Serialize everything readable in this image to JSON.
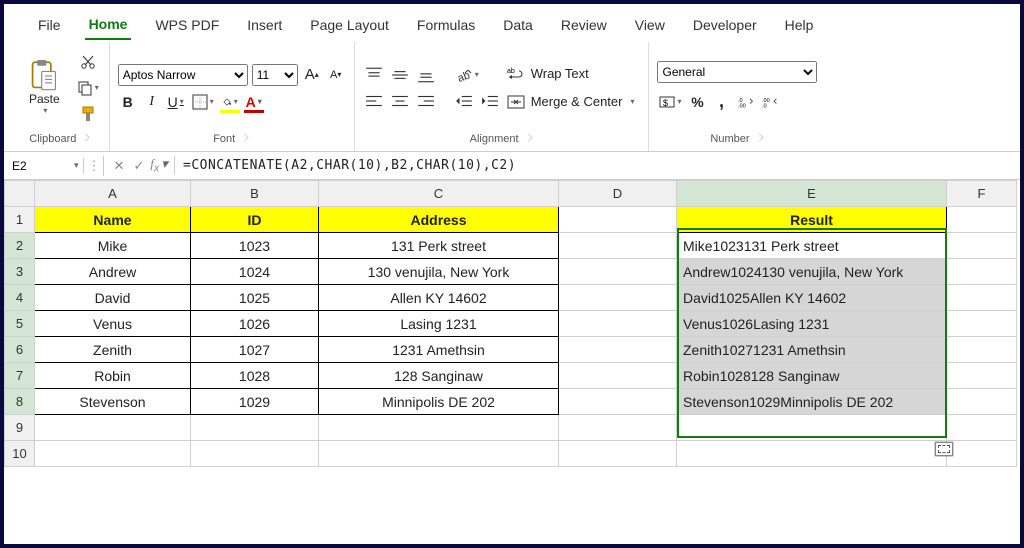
{
  "tabs": [
    "File",
    "Home",
    "WPS PDF",
    "Insert",
    "Page Layout",
    "Formulas",
    "Data",
    "Review",
    "View",
    "Developer",
    "Help"
  ],
  "active_tab": "Home",
  "ribbon": {
    "clipboard": {
      "label": "Clipboard",
      "paste": "Paste"
    },
    "font": {
      "label": "Font",
      "name": "Aptos Narrow",
      "size": "11"
    },
    "alignment": {
      "label": "Alignment",
      "wrap": "Wrap Text",
      "merge": "Merge & Center"
    },
    "number": {
      "label": "Number",
      "format": "General"
    }
  },
  "name_box": "E2",
  "formula": "=CONCATENATE(A2,CHAR(10),B2,CHAR(10),C2)",
  "columns": [
    "A",
    "B",
    "C",
    "D",
    "E",
    "F"
  ],
  "headers": {
    "A": "Name",
    "B": "ID",
    "C": "Address",
    "E": "Result"
  },
  "chart_data": {
    "type": "table",
    "columns": [
      "Name",
      "ID",
      "Address",
      "Result"
    ],
    "rows": [
      {
        "Name": "Mike",
        "ID": 1023,
        "Address": "131 Perk street",
        "Result": "Mike1023131 Perk street"
      },
      {
        "Name": "Andrew",
        "ID": 1024,
        "Address": "130 venujila, New York",
        "Result": "Andrew1024130 venujila, New York"
      },
      {
        "Name": "David",
        "ID": 1025,
        "Address": "Allen KY 14602",
        "Result": "David1025Allen KY 14602"
      },
      {
        "Name": "Venus",
        "ID": 1026,
        "Address": "Lasing 1231",
        "Result": "Venus1026Lasing 1231"
      },
      {
        "Name": "Zenith",
        "ID": 1027,
        "Address": "1231 Amethsin",
        "Result": "Zenith10271231 Amethsin"
      },
      {
        "Name": "Robin",
        "ID": 1028,
        "Address": "128 Sanginaw",
        "Result": "Robin1028128 Sanginaw"
      },
      {
        "Name": "Stevenson",
        "ID": 1029,
        "Address": "Minnipolis DE 202",
        "Result": "Stevenson1029Minnipolis DE 202"
      }
    ]
  }
}
